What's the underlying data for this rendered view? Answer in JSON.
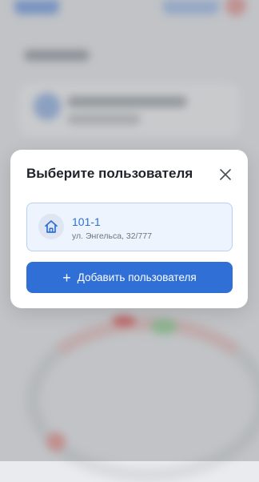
{
  "modal": {
    "title": "Выберите пользователя",
    "users": [
      {
        "name": "101-1",
        "address": "ул. Энгельса, 32/777"
      }
    ],
    "add_button_label": "Добавить пользователя",
    "add_icon": "+"
  },
  "icons": {
    "close": "close-icon",
    "home": "home-icon",
    "plus": "plus-icon"
  },
  "colors": {
    "accent": "#2f6fd6",
    "selected_card_bg": "#eef4fd",
    "selected_card_border": "#b8d0f3"
  }
}
